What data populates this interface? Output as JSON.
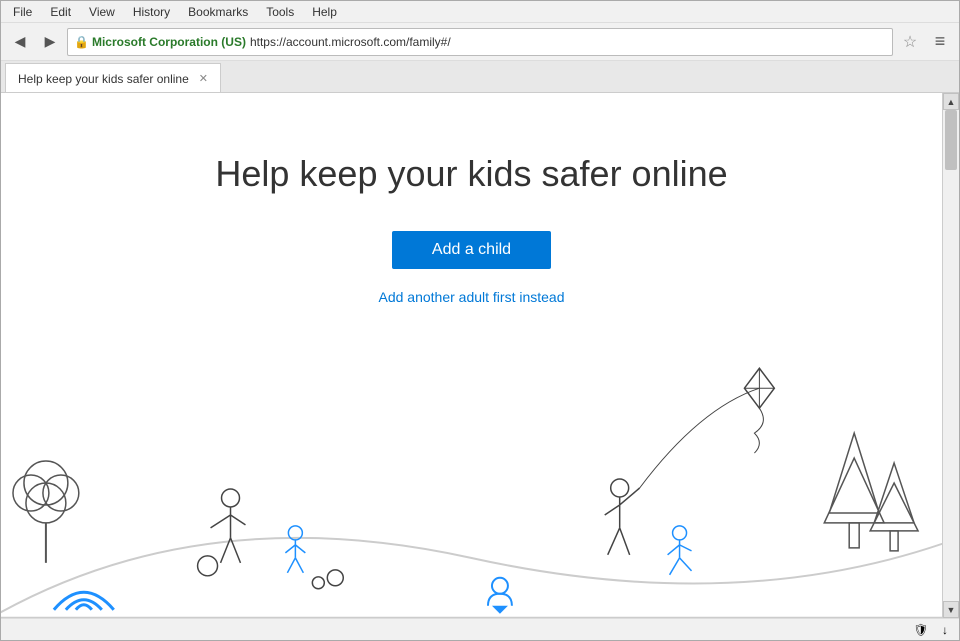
{
  "menu": {
    "items": [
      "File",
      "Edit",
      "View",
      "History",
      "Bookmarks",
      "Tools",
      "Help"
    ]
  },
  "navbar": {
    "back_label": "◀",
    "forward_label": "▶",
    "address": "https://account.microsoft.com/family#/",
    "company": "Microsoft Corporation (US)",
    "star_label": "☆",
    "menu_label": "≡"
  },
  "tab": {
    "title": "Help keep your kids safer online",
    "close_label": "✕"
  },
  "page": {
    "title": "Help keep your kids safer online",
    "add_child_label": "Add a child",
    "add_adult_label": "Add another adult first instead"
  },
  "scrollbar": {
    "up_label": "▲",
    "down_label": "▼"
  },
  "statusbar": {
    "shield_label": "🛡",
    "down_label": "↓"
  }
}
